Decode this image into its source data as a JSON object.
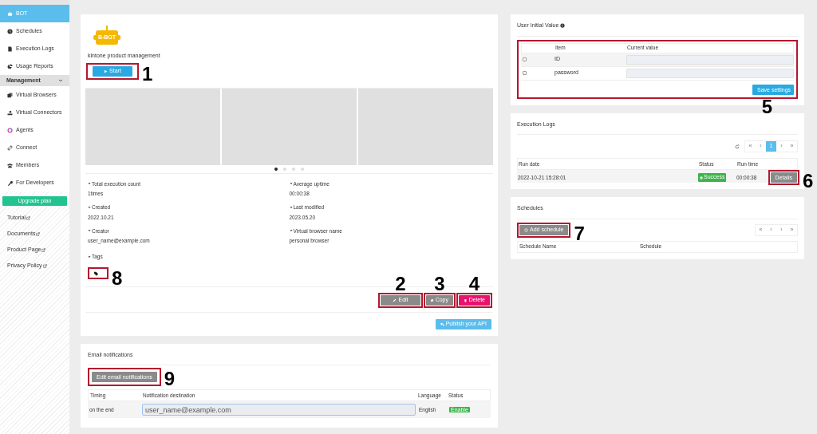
{
  "sidebar": {
    "items": [
      {
        "label": "BOT",
        "selected": true
      },
      {
        "label": "Schedules",
        "selected": false
      },
      {
        "label": "Execution Logs",
        "selected": false
      },
      {
        "label": "Usage Reports",
        "selected": false
      }
    ],
    "section": {
      "label": "Management",
      "expanded": true
    },
    "section_items": [
      {
        "label": "Virtual Browsers",
        "selected": false
      },
      {
        "label": "Virtual Connectors",
        "selected": false
      },
      {
        "label": "Agents",
        "selected": false
      },
      {
        "label": "Connect",
        "selected": false
      },
      {
        "label": "Members",
        "selected": false
      },
      {
        "label": "For Developers",
        "selected": false
      }
    ],
    "upgrade_button": "Upgrade plan",
    "links": [
      "Tutorial",
      "Documents",
      "Product Page",
      "Privacy Policy"
    ]
  },
  "bot_card": {
    "logo_text": "B-BOT",
    "title": "kintone product management",
    "start_button": {
      "label": "Start",
      "callout": "1"
    },
    "dots": [
      {
        "selected": true
      },
      {
        "selected": false
      },
      {
        "selected": false
      },
      {
        "selected": false
      }
    ],
    "stats": [
      {
        "label": "Total execution count",
        "value": "1times"
      },
      {
        "label": "Average uptime",
        "value": "00:00:38"
      },
      {
        "label": "Created",
        "value": "2022.10.21"
      },
      {
        "label": "Last modified",
        "value": "2023.05.20"
      },
      {
        "label": "Creator",
        "value": "user_name@example.com"
      },
      {
        "label": "Virtual browser name",
        "value": "personal browser"
      }
    ],
    "tags": {
      "label": "Tags",
      "callout": "8"
    },
    "actions": [
      {
        "kind": "edit",
        "label": "Edit",
        "callout": "2"
      },
      {
        "kind": "copy",
        "label": "Copy",
        "callout": "3"
      },
      {
        "kind": "delete",
        "label": "Delete",
        "callout": "4"
      }
    ],
    "publish_button": "Publish your API"
  },
  "email_card": {
    "title": "Email notifications",
    "edit_button": {
      "label": "Edit email notifications",
      "callout": "9"
    },
    "columns": [
      "Timing",
      "Notification destination",
      "Language",
      "Status"
    ],
    "rows": [
      {
        "timing": "on the end",
        "destination": "user_name@example.com",
        "language": "English",
        "status": "Enable"
      }
    ]
  },
  "initial_value_card": {
    "title": "User Initial Value",
    "columns": [
      "Item",
      "Current value"
    ],
    "rows": [
      {
        "item": "ID",
        "checked": false
      },
      {
        "item": "password",
        "checked": false
      }
    ],
    "save_button": "Save settings",
    "callout": "5"
  },
  "logs_card": {
    "title": "Execution Logs",
    "pagination": [
      {
        "label": "«",
        "selected": false
      },
      {
        "label": "‹",
        "selected": false
      },
      {
        "label": "1",
        "selected": true
      },
      {
        "label": "›",
        "selected": false
      },
      {
        "label": "»",
        "selected": false
      }
    ],
    "columns": [
      "Run date",
      "Status",
      "Run time"
    ],
    "rows": [
      {
        "run_date": "2022-10-21 15:28:01",
        "status": "Success",
        "run_time": "00:00:38",
        "action": "Details",
        "callout": "6"
      }
    ]
  },
  "schedules_card": {
    "title": "Schedules",
    "add_button": {
      "label": "Add schedule",
      "callout": "7"
    },
    "pagination": [
      {
        "label": "«",
        "selected": false
      },
      {
        "label": "‹",
        "selected": false
      },
      {
        "label": "›",
        "selected": false
      },
      {
        "label": "»",
        "selected": false
      }
    ],
    "columns": [
      "Schedule Name",
      "Schedule"
    ]
  }
}
